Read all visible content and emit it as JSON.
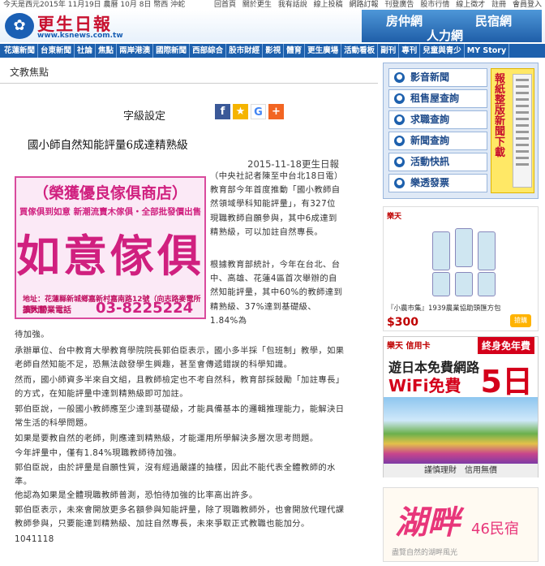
{
  "topbar": {
    "date": "今天是西元2015年 11月19日 農曆 10月 8日 幣西 沖蛇",
    "links": [
      "回首頁",
      "關於更生",
      "我有話說",
      "線上投稿",
      "網路訂報",
      "刊登廣告",
      "股市行情",
      "線上徵才",
      "註冊",
      "會員登入"
    ]
  },
  "header": {
    "logo_name": "更生日報",
    "logo_url": "www.ksnews.com.tw",
    "ads": [
      "房仲網",
      "民宿網",
      "人力網"
    ]
  },
  "nav": [
    "花蓮新聞",
    "台東新聞",
    "社論",
    "焦點",
    "兩岸港澳",
    "國際新聞",
    "西部綜合",
    "股市財經",
    "影視",
    "體育",
    "更生廣場",
    "活動看板",
    "副刊",
    "專刊",
    "兒童與青少",
    "MY Story"
  ],
  "section_title": "文教焦點",
  "toolbar": {
    "font_size_label": "字級設定",
    "share": {
      "fb": "f",
      "star": "★",
      "g": "G",
      "plus": "+"
    }
  },
  "article": {
    "title": "國小師自然知能評量6成達精熟級",
    "meta": "2015-11-18更生日報",
    "narrow_paragraphs": [
      "（中央社記者陳至中台北18日電）教育部今年首度推動「國小教師自然領域學科知能評量」，有327位現職教師自願參與，其中6成達到精熟級，可以加註自然專長。",
      "根據教育部統計，今年在台北、台中、高雄、花蓮4區首次舉辦的自然知能評量，其中60%的教師達到精熟級、37%達到基礎級、1.84%為"
    ],
    "wide_paragraphs": [
      "待加強。",
      "承辦單位、台中教育大學教育學院院長郭伯臣表示，國小多半採「包班制」教學，如果老師自然知能不足，恐無法啟發學生興趣，甚至會傳遞錯誤的科學知識。",
      "然而，國小師資多半來自文組，且教師檢定也不考自然科，教育部採鼓勵「加註專長」的方式，在知能評量中達到精熟級即可加註。",
      "郭伯臣說，一般國小教師應至少達到基礎級，才能具備基本的邏輯推理能力，能解決日常生活的科學問題。",
      "如果是要教自然的老師，則應達到精熟級，才能運用所學解決多層次思考問題。",
      "今年評量中，僅有1.84%現職教師待加強。",
      "郭伯臣說，由於評量是自願性質，沒有經過嚴謹的抽樣，因此不能代表全體教師的水準。",
      "他認為如果是全體現職教師普測，恐怕待加強的比率高出許多。",
      "郭伯臣表示，未來會開放更多名額參與知能評量，除了現職教師外，也會開放代理代課教師參與，只要能達到精熟級、加註自然專長，未來爭取正式教職也能加分。",
      "1041118"
    ]
  },
  "furniture_ad": {
    "line1": "（榮獲優良傢俱商店）",
    "line2": "買傢俱到如意 新潮流賣木傢俱・全部批發價出售",
    "line3": "如意傢俱",
    "line4": "地址：花蓮縣新城鄉嘉新村嘉南路12號（向志路麥電所正對面）",
    "line5": "擴大營業電話",
    "line6": "03-8225224"
  },
  "services": {
    "buttons": [
      "影音新聞",
      "租售屋查詢",
      "求職查詢",
      "新聞查詢",
      "活動快訊",
      "樂透發票"
    ],
    "promo": "報紙整版新聞下載"
  },
  "shop_ad": {
    "brand": "樂天",
    "desc": "『小農市集』1939農業協助頭匯方包",
    "price": "$300",
    "buy": "搶購"
  },
  "wifi_ad": {
    "brand": "樂天 信用卡",
    "badge": "終身免年費",
    "line1": "遊日本免費網路",
    "line2": "WiFi免費",
    "days": "5日",
    "footer": "謹慎理財　信用無價"
  },
  "inn_ad": {
    "name": "湖畔",
    "sub": "46民宿",
    "note": "盡覽自然的湖畔風光"
  }
}
